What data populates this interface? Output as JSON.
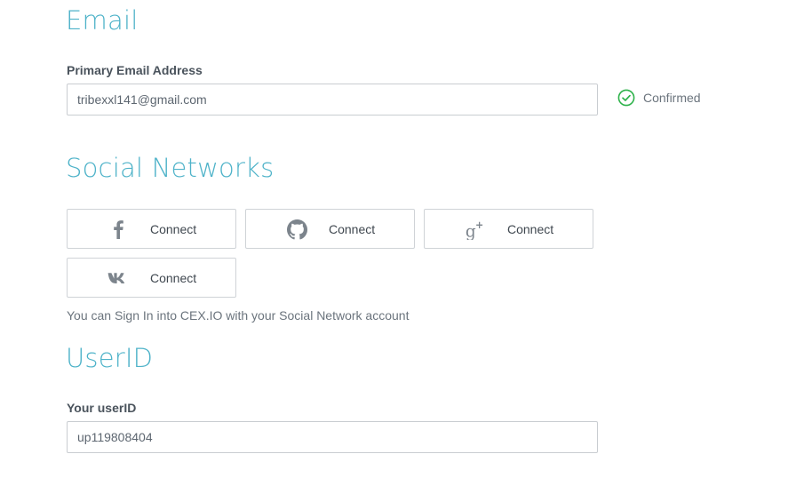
{
  "email_section": {
    "title": "Email",
    "label": "Primary Email Address",
    "value": "tribexxl141@gmail.com",
    "status": "Confirmed",
    "status_icon": "check-circle-icon",
    "status_color": "#2db24a"
  },
  "social_section": {
    "title": "Social Networks",
    "buttons": [
      {
        "network": "facebook",
        "icon": "facebook-icon",
        "label": "Connect"
      },
      {
        "network": "github",
        "icon": "github-icon",
        "label": "Connect"
      },
      {
        "network": "google-plus",
        "icon": "google-plus-icon",
        "label": "Connect"
      },
      {
        "network": "vk",
        "icon": "vk-icon",
        "label": "Connect"
      }
    ],
    "hint": "You can Sign In into CEX.IO with your Social Network account"
  },
  "userid_section": {
    "title": "UserID",
    "label": "Your userID",
    "value": "up119808404"
  },
  "colors": {
    "accent": "#4fb3c9",
    "icon_gray": "#7c848c",
    "text": "#4a535c"
  }
}
